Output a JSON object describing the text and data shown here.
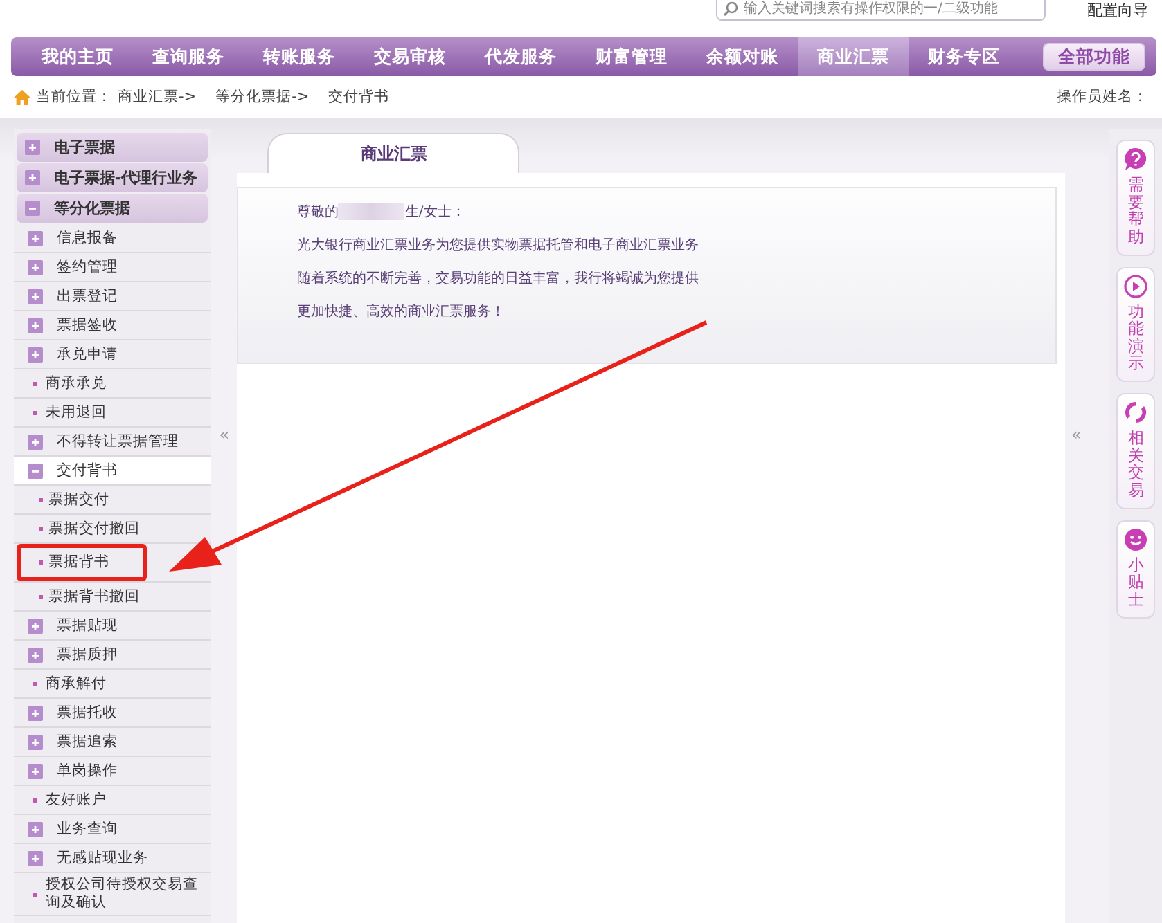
{
  "header": {
    "search": {
      "placeholder": "输入关键词搜索有操作权限的一/二级功能"
    },
    "setup_link": "配置向导"
  },
  "nav": {
    "items": [
      {
        "label": "我的主页",
        "selected": false
      },
      {
        "label": "查询服务",
        "selected": false
      },
      {
        "label": "转账服务",
        "selected": false
      },
      {
        "label": "交易审核",
        "selected": false
      },
      {
        "label": "代发服务",
        "selected": false
      },
      {
        "label": "财富管理",
        "selected": false
      },
      {
        "label": "余额对账",
        "selected": false
      },
      {
        "label": "商业汇票",
        "selected": true
      },
      {
        "label": "财务专区",
        "selected": false
      }
    ],
    "all_button": "全部功能"
  },
  "breadcrumb": {
    "label": "当前位置：",
    "crumbs": [
      "商业汇票->",
      "等分化票据->",
      "交付背书"
    ],
    "operator": "操作员姓名："
  },
  "sidebar": {
    "collapse": "«",
    "items": [
      {
        "kind": "group",
        "label": "电子票据",
        "expanded": false
      },
      {
        "kind": "group",
        "label": "电子票据-代理行业务",
        "expanded": false
      },
      {
        "kind": "group",
        "label": "等分化票据",
        "expanded": true,
        "children": [
          {
            "kind": "folder",
            "label": "信息报备",
            "expanded": false
          },
          {
            "kind": "folder",
            "label": "签约管理",
            "expanded": false
          },
          {
            "kind": "folder",
            "label": "出票登记",
            "expanded": false
          },
          {
            "kind": "folder",
            "label": "票据签收",
            "expanded": false
          },
          {
            "kind": "folder",
            "label": "承兑申请",
            "expanded": false
          },
          {
            "kind": "leaf",
            "label": "商承承兑"
          },
          {
            "kind": "leaf",
            "label": "未用退回"
          },
          {
            "kind": "folder",
            "label": "不得转让票据管理",
            "expanded": false
          },
          {
            "kind": "folder",
            "label": "交付背书",
            "expanded": true,
            "children": [
              {
                "kind": "leaf",
                "label": "票据交付",
                "annotated": false
              },
              {
                "kind": "leaf",
                "label": "票据交付撤回",
                "annotated": false
              },
              {
                "kind": "leaf",
                "label": "票据背书",
                "annotated": true
              },
              {
                "kind": "leaf",
                "label": "票据背书撤回",
                "annotated": false
              }
            ]
          },
          {
            "kind": "folder",
            "label": "票据贴现",
            "expanded": false
          },
          {
            "kind": "folder",
            "label": "票据质押",
            "expanded": false
          },
          {
            "kind": "leaf",
            "label": "商承解付"
          },
          {
            "kind": "folder",
            "label": "票据托收",
            "expanded": false
          },
          {
            "kind": "folder",
            "label": "票据追索",
            "expanded": false
          },
          {
            "kind": "folder",
            "label": "单岗操作",
            "expanded": false
          },
          {
            "kind": "leaf",
            "label": "友好账户"
          },
          {
            "kind": "folder",
            "label": "业务查询",
            "expanded": false
          },
          {
            "kind": "folder",
            "label": "无感贴现业务",
            "expanded": false
          },
          {
            "kind": "leaf",
            "label": "授权公司待授权交易查询及确认"
          }
        ]
      }
    ]
  },
  "main": {
    "tab": "商业汇票",
    "collapse": "«",
    "greeting_prefix": "尊敬的",
    "greeting_suffix": "生/女士：",
    "lines": [
      "光大银行商业汇票业务为您提供实物票据托管和电子商业汇票业务",
      "随着系统的不断完善，交易功能的日益丰富，我行将竭诚为您提供",
      "更加快捷、高效的商业汇票服务！"
    ]
  },
  "right_bar": [
    {
      "kind": "help",
      "label": "需要帮助"
    },
    {
      "kind": "demo",
      "label": "功能演示"
    },
    {
      "kind": "related",
      "label": "相关交易"
    },
    {
      "kind": "tips",
      "label": "小贴士"
    }
  ]
}
